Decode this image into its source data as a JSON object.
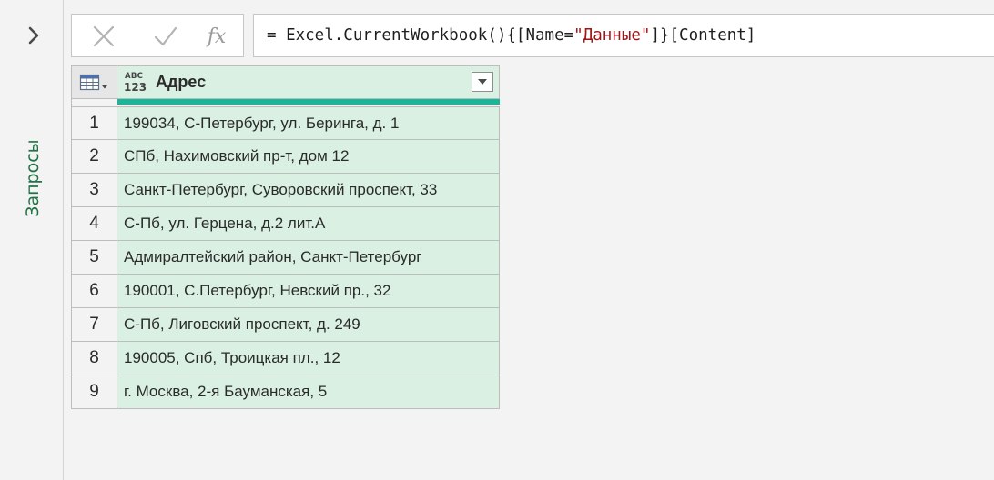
{
  "sidebar": {
    "label": "Запросы",
    "expand_icon": "chevron-right-icon"
  },
  "formula_bar": {
    "cancel_icon": "close-icon",
    "confirm_icon": "checkmark-icon",
    "fx_label": "fx",
    "formula_prefix": "= Excel.CurrentWorkbook(){[Name=",
    "formula_string": "\"Данные\"",
    "formula_suffix": "]}[Content]"
  },
  "table": {
    "column": {
      "type_icon_top": "ABC",
      "type_icon_bottom": "123",
      "title": "Адрес",
      "filter_icon": "dropdown-arrow-icon"
    },
    "quality_color": "#19b79a",
    "rows": [
      {
        "num": "1",
        "value": "199034, С-Петербург, ул. Беринга, д. 1"
      },
      {
        "num": "2",
        "value": "СПб, Нахимовский пр-т, дом 12"
      },
      {
        "num": "3",
        "value": "Санкт-Петербург, Суворовский проспект, 33"
      },
      {
        "num": "4",
        "value": "С-Пб, ул. Герцена, д.2 лит.А"
      },
      {
        "num": "5",
        "value": "Адмиралтейский район, Санкт-Петербург"
      },
      {
        "num": "6",
        "value": "190001, С.Петербург, Невский пр., 32"
      },
      {
        "num": "7",
        "value": "С-Пб, Лиговский проспект, д. 249"
      },
      {
        "num": "8",
        "value": "190005, Спб, Троицкая пл., 12"
      },
      {
        "num": "9",
        "value": "г. Москва, 2-я Бауманская, 5"
      }
    ]
  },
  "colors": {
    "accent_green": "#217346",
    "cell_fill": "#d9f0e2",
    "string_literal": "#a31515"
  }
}
